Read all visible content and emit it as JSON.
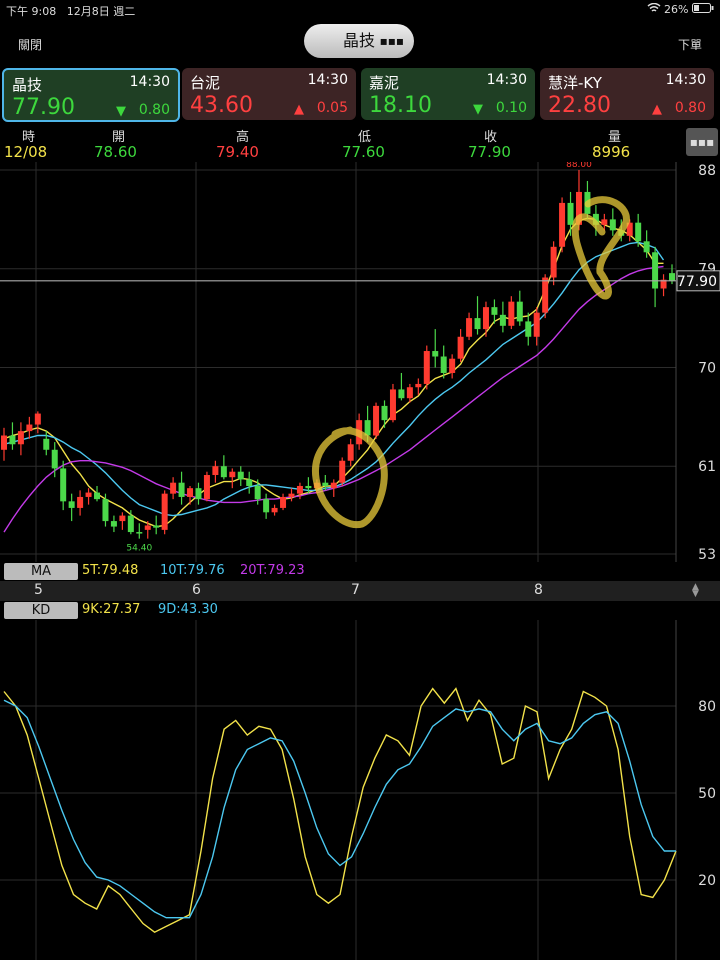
{
  "status": {
    "time": "下午 9:08",
    "date": "12月8日 週二",
    "battery": "26%",
    "battery_icon": "battery-icon",
    "wifi_icon": "wifi-icon"
  },
  "nav": {
    "close": "關閉",
    "title": "晶技",
    "order": "下單",
    "menu_icon": "menu-icon"
  },
  "cards": [
    {
      "name": "晶技",
      "time": "14:30",
      "price": "77.90",
      "change": "0.80",
      "dir": "down"
    },
    {
      "name": "台泥",
      "time": "14:30",
      "price": "43.60",
      "change": "0.05",
      "dir": "up"
    },
    {
      "name": "嘉泥",
      "time": "14:30",
      "price": "18.10",
      "change": "0.10",
      "dir": "down"
    },
    {
      "name": "慧洋-KY",
      "time": "14:30",
      "price": "22.80",
      "change": "0.80",
      "dir": "up"
    }
  ],
  "ohlc": {
    "labels": [
      "時",
      "開",
      "高",
      "低",
      "收",
      "量"
    ],
    "values": [
      "12/08",
      "78.60",
      "79.40",
      "77.60",
      "77.90",
      "8996"
    ]
  },
  "ma": {
    "label": "MA",
    "ma5": "5T:79.48",
    "ma10": "10T:79.76",
    "ma20": "20T:79.23"
  },
  "kd": {
    "label": "KD",
    "k": "9K:27.37",
    "d": "9D:43.30"
  },
  "chart_data": [
    {
      "type": "candlestick",
      "y_ticks": [
        "88",
        "79",
        "70",
        "61",
        "53"
      ],
      "ylim": [
        53,
        88
      ],
      "x_ticks": [
        "5",
        "6",
        "7",
        "8"
      ],
      "last_price": "77.90",
      "high_label": "88.00",
      "low_label": "54.40",
      "candles": [
        {
          "o": 62.5,
          "h": 64.5,
          "l": 61.5,
          "c": 63.8
        },
        {
          "o": 63.8,
          "h": 65,
          "l": 62.5,
          "c": 63
        },
        {
          "o": 63,
          "h": 65,
          "l": 62,
          "c": 64.2
        },
        {
          "o": 64.2,
          "h": 65.5,
          "l": 63.5,
          "c": 64.8
        },
        {
          "o": 64.8,
          "h": 66,
          "l": 64,
          "c": 65.8
        },
        {
          "o": 63.5,
          "h": 64.2,
          "l": 62,
          "c": 62.5
        },
        {
          "o": 62.5,
          "h": 63.2,
          "l": 60,
          "c": 60.8
        },
        {
          "o": 60.8,
          "h": 61.5,
          "l": 57,
          "c": 57.8
        },
        {
          "o": 57.8,
          "h": 58.5,
          "l": 56,
          "c": 57.2
        },
        {
          "o": 57.2,
          "h": 58.8,
          "l": 56.5,
          "c": 58.2
        },
        {
          "o": 58.2,
          "h": 59,
          "l": 57.5,
          "c": 58.6
        },
        {
          "o": 58.6,
          "h": 59.2,
          "l": 57.8,
          "c": 58
        },
        {
          "o": 58,
          "h": 58.5,
          "l": 55.5,
          "c": 56
        },
        {
          "o": 56,
          "h": 56.5,
          "l": 55,
          "c": 55.5
        },
        {
          "o": 56,
          "h": 56.8,
          "l": 55.2,
          "c": 56.5
        },
        {
          "o": 56.5,
          "h": 57,
          "l": 54.8,
          "c": 55
        },
        {
          "o": 55,
          "h": 55.8,
          "l": 54.4,
          "c": 54.9
        },
        {
          "o": 55.2,
          "h": 56,
          "l": 54.4,
          "c": 55.6
        },
        {
          "o": 55.6,
          "h": 56.5,
          "l": 54.8,
          "c": 55.4
        },
        {
          "o": 55.2,
          "h": 58.8,
          "l": 54.8,
          "c": 58.5
        },
        {
          "o": 58.5,
          "h": 60,
          "l": 58,
          "c": 59.5
        },
        {
          "o": 59.5,
          "h": 60.5,
          "l": 57.5,
          "c": 58.2
        },
        {
          "o": 58.2,
          "h": 59.2,
          "l": 57.5,
          "c": 59
        },
        {
          "o": 59,
          "h": 59.5,
          "l": 57.5,
          "c": 58
        },
        {
          "o": 58,
          "h": 60.5,
          "l": 57.8,
          "c": 60.2
        },
        {
          "o": 60.2,
          "h": 61.5,
          "l": 59.5,
          "c": 61
        },
        {
          "o": 61,
          "h": 62,
          "l": 59.8,
          "c": 60
        },
        {
          "o": 60,
          "h": 60.8,
          "l": 59,
          "c": 60.5
        },
        {
          "o": 60.5,
          "h": 61,
          "l": 59.2,
          "c": 59.8
        },
        {
          "o": 59.8,
          "h": 60.5,
          "l": 58.5,
          "c": 59.2
        },
        {
          "o": 59.2,
          "h": 59.8,
          "l": 57.5,
          "c": 58
        },
        {
          "o": 58,
          "h": 58.5,
          "l": 56.2,
          "c": 56.8
        },
        {
          "o": 56.8,
          "h": 57.5,
          "l": 56.5,
          "c": 57.2
        },
        {
          "o": 57.2,
          "h": 58.5,
          "l": 57,
          "c": 58.2
        },
        {
          "o": 58.2,
          "h": 59,
          "l": 57.8,
          "c": 58.5
        },
        {
          "o": 58.5,
          "h": 59.5,
          "l": 58,
          "c": 59.2
        },
        {
          "o": 59.2,
          "h": 60,
          "l": 58.5,
          "c": 59
        },
        {
          "o": 59,
          "h": 59.8,
          "l": 58.5,
          "c": 59.5
        },
        {
          "o": 59.5,
          "h": 60.2,
          "l": 58.8,
          "c": 59.2
        },
        {
          "o": 59,
          "h": 59.8,
          "l": 58.2,
          "c": 59.5
        },
        {
          "o": 59.5,
          "h": 61.8,
          "l": 59.2,
          "c": 61.5
        },
        {
          "o": 61.5,
          "h": 63.5,
          "l": 61,
          "c": 63
        },
        {
          "o": 63,
          "h": 65.8,
          "l": 62.5,
          "c": 65.2
        },
        {
          "o": 65.2,
          "h": 66.5,
          "l": 63.2,
          "c": 63.8
        },
        {
          "o": 63.8,
          "h": 66.8,
          "l": 63.5,
          "c": 66.5
        },
        {
          "o": 66.5,
          "h": 67,
          "l": 64.5,
          "c": 65.2
        },
        {
          "o": 65.2,
          "h": 68.5,
          "l": 65,
          "c": 68
        },
        {
          "o": 68,
          "h": 69.5,
          "l": 67,
          "c": 67.2
        },
        {
          "o": 67.2,
          "h": 68.5,
          "l": 66.8,
          "c": 68.2
        },
        {
          "o": 68.2,
          "h": 69,
          "l": 67.5,
          "c": 68.5
        },
        {
          "o": 68.5,
          "h": 72,
          "l": 68,
          "c": 71.5
        },
        {
          "o": 71.5,
          "h": 73.5,
          "l": 70,
          "c": 71
        },
        {
          "o": 71,
          "h": 72,
          "l": 69,
          "c": 69.5
        },
        {
          "o": 69.5,
          "h": 71.2,
          "l": 69,
          "c": 70.8
        },
        {
          "o": 70.8,
          "h": 73.5,
          "l": 70.5,
          "c": 72.8
        },
        {
          "o": 72.8,
          "h": 75,
          "l": 72.5,
          "c": 74.5
        },
        {
          "o": 74.5,
          "h": 76.5,
          "l": 73,
          "c": 73.5
        },
        {
          "o": 73.5,
          "h": 76,
          "l": 72.8,
          "c": 75.5
        },
        {
          "o": 75.5,
          "h": 76.2,
          "l": 74,
          "c": 74.8
        },
        {
          "o": 74.8,
          "h": 76,
          "l": 73.2,
          "c": 73.8
        },
        {
          "o": 73.8,
          "h": 76.5,
          "l": 73.5,
          "c": 76
        },
        {
          "o": 76,
          "h": 77,
          "l": 73.8,
          "c": 74.2
        },
        {
          "o": 74.2,
          "h": 75,
          "l": 72,
          "c": 72.8
        },
        {
          "o": 72.8,
          "h": 75.5,
          "l": 72,
          "c": 75
        },
        {
          "o": 75,
          "h": 78.5,
          "l": 74.5,
          "c": 78.2
        },
        {
          "o": 78.2,
          "h": 81.5,
          "l": 77.5,
          "c": 81
        },
        {
          "o": 81,
          "h": 85.5,
          "l": 80.5,
          "c": 85
        },
        {
          "o": 85,
          "h": 86,
          "l": 82,
          "c": 83
        },
        {
          "o": 83,
          "h": 88,
          "l": 82.5,
          "c": 86
        },
        {
          "o": 86,
          "h": 87,
          "l": 83.5,
          "c": 84
        },
        {
          "o": 84,
          "h": 84.8,
          "l": 82,
          "c": 83
        },
        {
          "o": 83,
          "h": 84,
          "l": 82.5,
          "c": 83.5
        },
        {
          "o": 83.5,
          "h": 84.5,
          "l": 82,
          "c": 82.5
        },
        {
          "o": 82.5,
          "h": 83.5,
          "l": 81.5,
          "c": 82
        },
        {
          "o": 82,
          "h": 83.5,
          "l": 81.5,
          "c": 83.2
        },
        {
          "o": 83.2,
          "h": 84,
          "l": 81,
          "c": 81.5
        },
        {
          "o": 81.5,
          "h": 82.5,
          "l": 80,
          "c": 80.5
        },
        {
          "o": 80.5,
          "h": 81,
          "l": 75.5,
          "c": 77.2
        },
        {
          "o": 77.2,
          "h": 78.5,
          "l": 76.5,
          "c": 78
        },
        {
          "o": 78.6,
          "h": 79.4,
          "l": 77.6,
          "c": 77.9
        }
      ],
      "series": [
        {
          "name": "5T",
          "color": "#f2e24a",
          "values": [
            63.5,
            63.8,
            64,
            64.3,
            64.5,
            64.2,
            63.6,
            62.4,
            61.2,
            60.3,
            59.2,
            58.5,
            58,
            57.6,
            57.2,
            56.6,
            56.1,
            55.8,
            55.5,
            55.6,
            56.2,
            57,
            57.7,
            58.4,
            59,
            59.3,
            59.6,
            59.6,
            59.9,
            59.8,
            59.5,
            58.9,
            58.4,
            58,
            58.1,
            58.4,
            58.6,
            58.9,
            59.2,
            59.2,
            59.9,
            60.7,
            61.6,
            62.5,
            63.7,
            64.8,
            65.7,
            66.2,
            66.9,
            67.4,
            68.4,
            69,
            69.3,
            69.6,
            70.3,
            71.7,
            72.5,
            73.2,
            74.2,
            74.6,
            74.4,
            74.6,
            74.7,
            75.3,
            77.1,
            79,
            81.1,
            82.6,
            83.4,
            83.6,
            83.5,
            83,
            82.7,
            82.5,
            82.1,
            81.4,
            80.7,
            79.5,
            79.5
          ]
        },
        {
          "name": "10T",
          "color": "#4cc8f0",
          "values": [
            63,
            63.2,
            63.4,
            63.6,
            63.8,
            63.8,
            63.6,
            63.2,
            62.7,
            62.3,
            61.7,
            61.1,
            60.4,
            59.6,
            58.8,
            58.1,
            57.5,
            57.2,
            56.9,
            56.6,
            56.5,
            56.6,
            56.8,
            57,
            57.2,
            57.5,
            58,
            58.4,
            58.8,
            59.1,
            59.3,
            59.3,
            59.2,
            59.1,
            59,
            58.9,
            58.8,
            58.8,
            59,
            59.1,
            59.4,
            59.8,
            60.3,
            60.8,
            61.4,
            62.2,
            63.1,
            63.9,
            64.7,
            65.6,
            66.4,
            67.1,
            67.7,
            68.2,
            68.8,
            69.5,
            70.1,
            70.7,
            71.4,
            72.1,
            72.6,
            73.1,
            73.6,
            74.1,
            74.9,
            75.8,
            76.8,
            77.9,
            78.9,
            79.6,
            80.1,
            80.4,
            80.7,
            81,
            81.3,
            81.4,
            81.2,
            80.9,
            79.8
          ]
        },
        {
          "name": "20T",
          "color": "#c33ae8",
          "values": [
            55,
            56.2,
            57.3,
            58.3,
            59.2,
            60,
            60.6,
            61.1,
            61.4,
            61.5,
            61.5,
            61.4,
            61.3,
            61.1,
            60.9,
            60.6,
            60.2,
            59.8,
            59.4,
            59.1,
            58.8,
            58.5,
            58.3,
            58.1,
            57.9,
            57.8,
            57.7,
            57.7,
            57.7,
            57.8,
            57.9,
            58,
            58,
            58.1,
            58.2,
            58.3,
            58.5,
            58.6,
            58.8,
            59,
            59.2,
            59.5,
            59.8,
            60.2,
            60.6,
            61,
            61.5,
            62,
            62.5,
            63.1,
            63.7,
            64.3,
            64.9,
            65.5,
            66.1,
            66.7,
            67.3,
            67.9,
            68.5,
            69.1,
            69.6,
            70.1,
            70.6,
            71.1,
            71.8,
            72.6,
            73.5,
            74.4,
            75.3,
            76,
            76.6,
            77.1,
            77.6,
            78.1,
            78.5,
            78.8,
            79,
            79.1,
            79.2
          ]
        }
      ]
    },
    {
      "type": "line",
      "y_ticks": [
        "80",
        "50",
        "20"
      ],
      "ylim": [
        0,
        100
      ],
      "series": [
        {
          "name": "9K",
          "color": "#f2e24a",
          "values": [
            85,
            80,
            70,
            55,
            40,
            25,
            15,
            12,
            10,
            18,
            15,
            10,
            5,
            2,
            4,
            6,
            8,
            30,
            55,
            72,
            75,
            70,
            73,
            72,
            65,
            48,
            28,
            15,
            12,
            15,
            35,
            52,
            62,
            70,
            68,
            63,
            80,
            86,
            81,
            86,
            75,
            82,
            77,
            60,
            62,
            80,
            78,
            55,
            65,
            72,
            85,
            83,
            80,
            65,
            35,
            15,
            14,
            20,
            30
          ]
        },
        {
          "name": "9D",
          "color": "#4cc8f0",
          "values": [
            82,
            80,
            76,
            66,
            55,
            44,
            34,
            26,
            21,
            20,
            18,
            15,
            12,
            9,
            7,
            7,
            7,
            15,
            28,
            45,
            58,
            65,
            67,
            69,
            68,
            61,
            50,
            38,
            29,
            25,
            28,
            36,
            45,
            53,
            58,
            60,
            66,
            73,
            76,
            79,
            78,
            79,
            78,
            72,
            68,
            72,
            74,
            68,
            67,
            69,
            74,
            77,
            78,
            74,
            61,
            46,
            35,
            30,
            30
          ]
        }
      ]
    }
  ]
}
